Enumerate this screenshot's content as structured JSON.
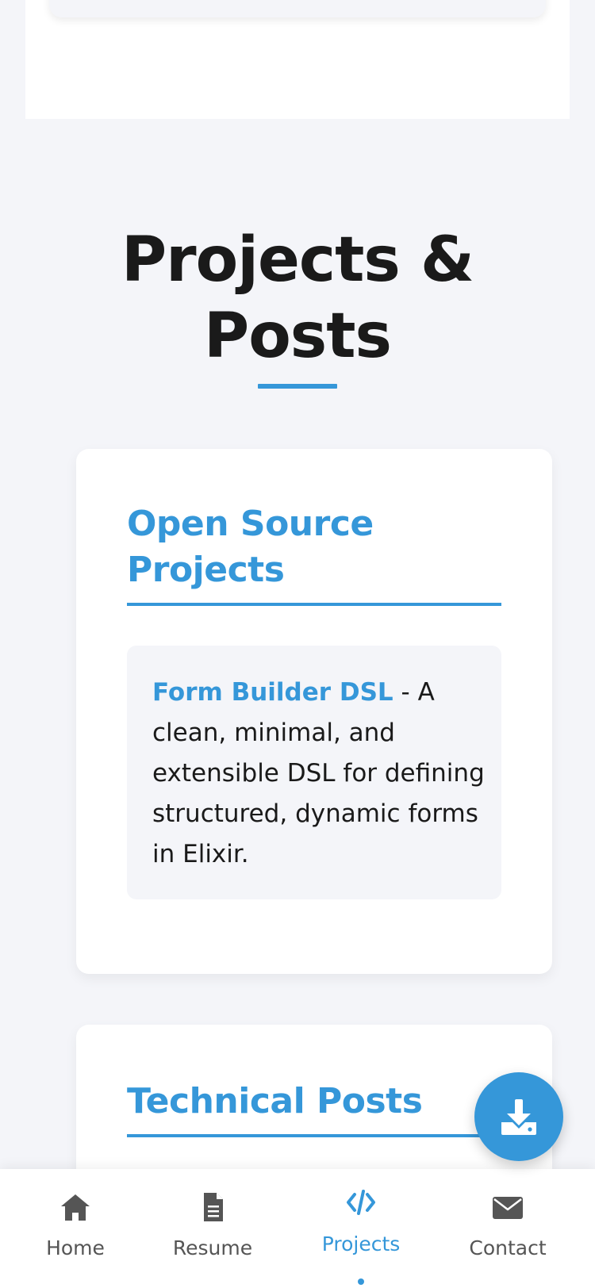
{
  "section": {
    "title_line1": "Projects &",
    "title_line2": "Posts"
  },
  "open_source": {
    "heading_line1": "Open Source",
    "heading_line2": "Projects",
    "items": [
      {
        "name": "Form Builder DSL",
        "separator": " - ",
        "description": "A clean, minimal, and extensible DSL for defining structured, dynamic forms in Elixir."
      }
    ]
  },
  "technical_posts": {
    "heading": "Technical Posts"
  },
  "fab": {
    "icon": "download-icon"
  },
  "nav": {
    "items": [
      {
        "label": "Home",
        "icon": "home-icon"
      },
      {
        "label": "Resume",
        "icon": "file-icon"
      },
      {
        "label": "Projects",
        "icon": "code-icon"
      },
      {
        "label": "Contact",
        "icon": "envelope-icon"
      }
    ],
    "active_index": 2
  },
  "colors": {
    "accent": "#3597d9",
    "background": "#f4f5f9",
    "text": "#1a1a1a",
    "nav_inactive": "#555555"
  }
}
